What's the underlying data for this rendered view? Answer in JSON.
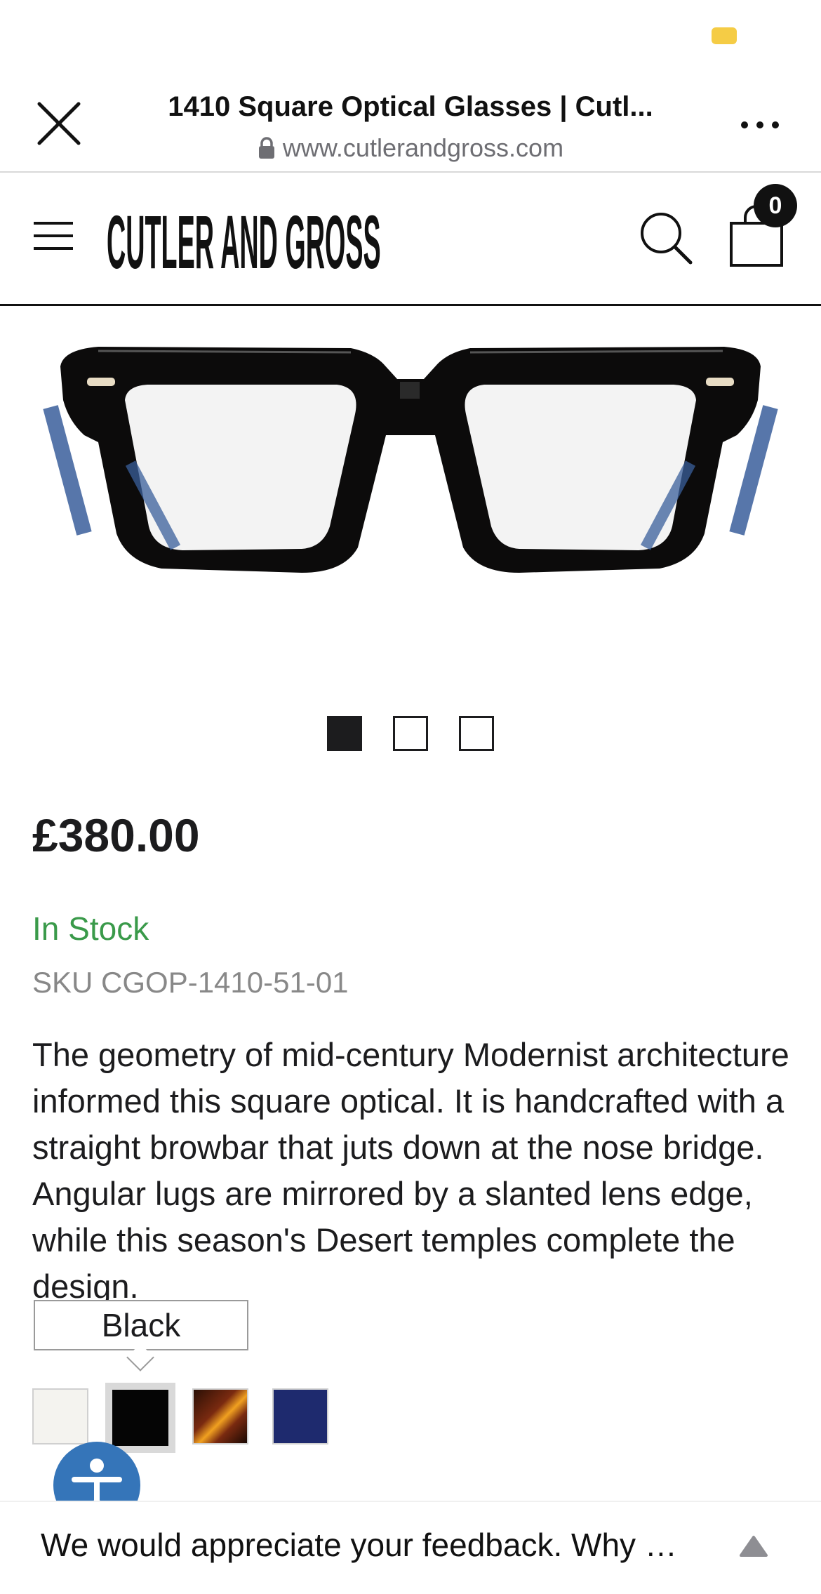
{
  "browser": {
    "page_title": "1410 Square Optical Glasses | Cutl...",
    "url": "www.cutlerandgross.com",
    "close_icon": "close-icon",
    "more_icon": "more-horizontal-icon"
  },
  "site_header": {
    "logo_text": "CUTLER AND GROSS",
    "menu_icon": "hamburger-menu-icon",
    "search_icon": "search-icon",
    "cart_icon": "shopping-bag-icon",
    "cart_count": "0"
  },
  "product": {
    "image_alt": "1410 Square Optical Glasses in Black",
    "carousel": {
      "total_slides": 3,
      "active_slide": 1
    },
    "price": "£380.00",
    "stock_status": "In Stock",
    "sku": "SKU CGOP-1410-51-01",
    "description": "The geometry of mid-century Modernist architecture informed this square optical. It is handcrafted with a straight browbar that juts down at the nose bridge. Angular lugs are mirrored by a slanted lens edge, while this season's Desert temples complete the design.",
    "colour_label": "Colour: Black",
    "tooltip": "Black",
    "swatches": [
      {
        "name": "White",
        "color": "#f4f3ef"
      },
      {
        "name": "Black",
        "color": "#050505",
        "selected": true
      },
      {
        "name": "Tortoise",
        "color": "#7a2a10"
      },
      {
        "name": "Navy",
        "color": "#1e2a6e"
      }
    ]
  },
  "accessibility": {
    "icon": "accessibility-icon"
  },
  "feedback": {
    "text": "We would appreciate your feedback. Why …",
    "toggle_icon": "triangle-up-icon"
  },
  "colors": {
    "in_stock": "#3a9a4a",
    "accessibility_button": "#3575b9",
    "status_indicator": "#f5cc45"
  }
}
